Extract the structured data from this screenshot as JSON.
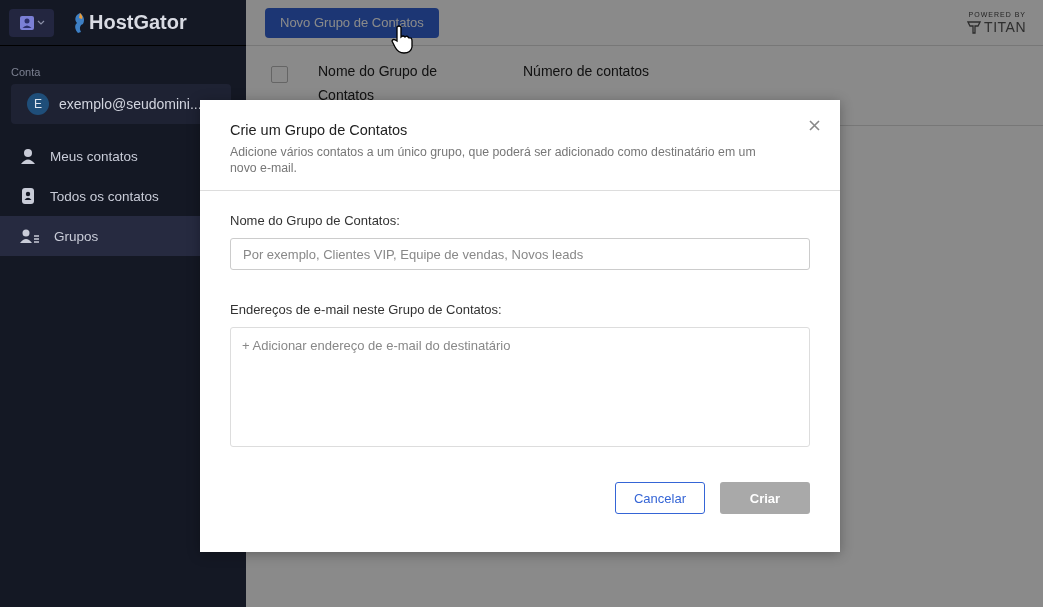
{
  "sidebar": {
    "brand": "HostGator",
    "account_label": "Conta",
    "account": {
      "initial": "E",
      "email": "exemplo@seudomini..."
    },
    "items": [
      {
        "label": "Meus contatos",
        "kind": "person",
        "selected": false
      },
      {
        "label": "Todos os contatos",
        "kind": "contact-card",
        "selected": false
      },
      {
        "label": "Grupos",
        "kind": "group",
        "selected": true
      }
    ]
  },
  "toolbar": {
    "new_button": "Novo Grupo de Contatos",
    "powered_by": "POWERED BY",
    "powered_brand": "TITAN"
  },
  "table": {
    "columns": [
      "Nome do Grupo de Contatos",
      "Número de contatos"
    ],
    "select_all_checked": false
  },
  "dialog": {
    "title": "Crie um Grupo de Contatos",
    "description": "Adicione vários contatos a um único grupo, que poderá ser adicionado como destinatário em um novo e-mail.",
    "name_label": "Nome do Grupo de Contatos:",
    "name_placeholder": "Por exemplo, Clientes VIP, Equipe de vendas, Novos leads",
    "emails_label": "Endereços de e-mail neste Grupo de Contatos:",
    "emails_placeholder": "+ Adicionar endereço de e-mail do destinatário",
    "buttons": [
      {
        "label": "Cancelar",
        "kind": "secondary",
        "disabled": false
      },
      {
        "label": "Criar",
        "kind": "primary",
        "disabled": true
      }
    ]
  }
}
